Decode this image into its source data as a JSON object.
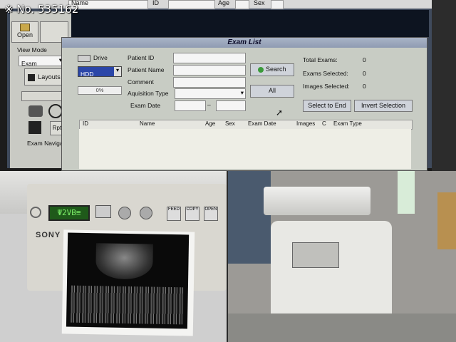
{
  "watermark": "※ No. 535162",
  "top_strip": {
    "name_col": "Name",
    "id_col": "ID",
    "age_col": "Age",
    "sex_col": "Sex"
  },
  "left_panel": {
    "open_label": "Open",
    "view_mode_label": "View Mode",
    "view_mode_value": "Exam",
    "layouts_label": "Layouts",
    "rpt_label": "Rpt",
    "exam_navigator_label": "Exam Navigator"
  },
  "dialog": {
    "title": "Exam List",
    "drive_label": "Drive",
    "drive_value": "HDD",
    "progress_text": "0%",
    "fields": {
      "patient_id": "Patient ID",
      "patient_name": "Patient Name",
      "comment": "Comment",
      "acquisition_type": "Aquisition Type",
      "exam_date": "Exam Date",
      "date_separator": "–"
    },
    "search_label": "Search",
    "all_label": "All",
    "stats": {
      "total_label": "Total Exams:",
      "total_value": "0",
      "selected_label": "Exams Selected:",
      "selected_value": "0",
      "images_label": "Images Selected:",
      "images_value": "0"
    },
    "goto_end_label": "Select to End",
    "invert_label": "Invert Selection",
    "columns": [
      "ID",
      "Name",
      "Age",
      "Sex",
      "Exam Date",
      "Images",
      "C",
      "Exam Type"
    ]
  },
  "printer": {
    "brand": "SONY",
    "display_text": "Ψ2VB≡",
    "buttons": [
      "FEED",
      "COPY",
      "OPEN"
    ]
  },
  "colors": {
    "dialog_bg": "#c8ccc4",
    "title_bg": "#9aa6bb",
    "screen_bg": "#3f4a5c"
  }
}
